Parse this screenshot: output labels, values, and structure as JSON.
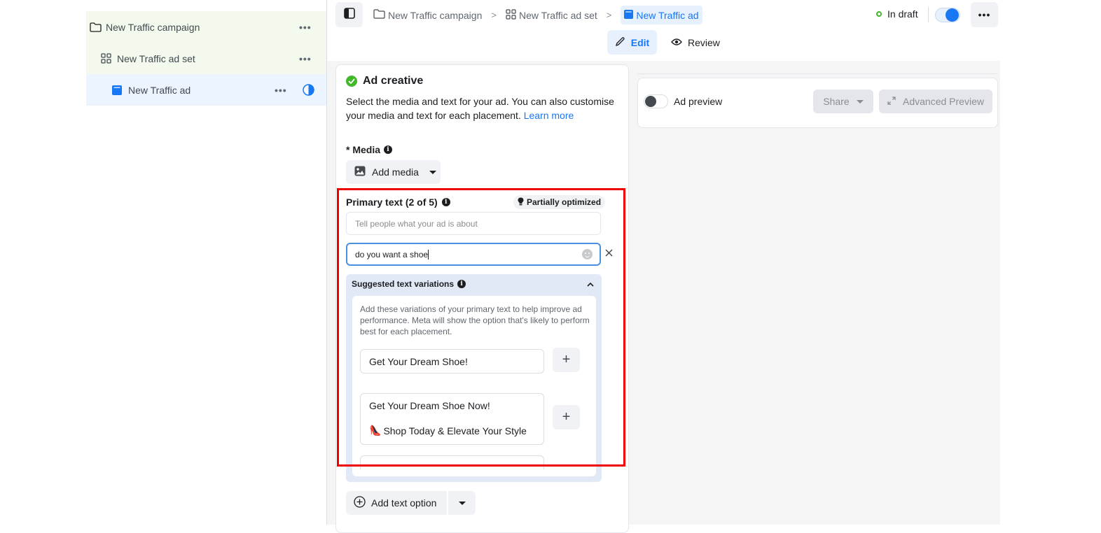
{
  "tree": {
    "campaign": {
      "label": "New Traffic campaign",
      "icon": "folder-icon",
      "more": "•••"
    },
    "adset": {
      "label": "New Traffic ad set",
      "icon": "grid-icon",
      "more": "•••"
    },
    "ad": {
      "label": "New Traffic ad",
      "icon": "ad-icon",
      "more": "•••",
      "status_icon": "half-circle-icon"
    }
  },
  "topbar": {
    "breadcrumbs": [
      {
        "label": "New Traffic campaign",
        "icon": "folder-icon"
      },
      {
        "label": "New Traffic ad set",
        "icon": "grid-icon"
      },
      {
        "label": "New Traffic ad",
        "icon": "ad-icon"
      }
    ],
    "separator": ">",
    "status": "In draft",
    "toggle_on": true,
    "more": "•••",
    "tabs": [
      {
        "label": "Edit",
        "active": true
      },
      {
        "label": "Review",
        "active": false
      }
    ]
  },
  "creative": {
    "title": "Ad creative",
    "description": "Select the media and text for your ad. You can also customise your media and text for each placement.",
    "learn_more": "Learn more",
    "media_label": "* Media",
    "add_media": "Add media",
    "primary_text_label": "Primary text (2 of 5)",
    "optimization_badge": "Partially optimized",
    "primary_text_placeholder": "Tell people what your ad is about",
    "primary_text_value": "do you want a shoe",
    "suggestions": {
      "title": "Suggested text variations",
      "description": "Add these variations of your primary text to help improve ad performance. Meta will show the option that's likely to perform best for each placement.",
      "items": [
        {
          "line1": "Get Your Dream Shoe!"
        },
        {
          "line1": "Get Your Dream Shoe Now!",
          "emoji": "👠",
          "line2": "Shop Today & Elevate Your Style"
        }
      ],
      "add_symbol": "+"
    },
    "add_text_option": "Add text option"
  },
  "preview": {
    "label": "Ad preview",
    "toggle_on": false,
    "share": "Share",
    "advanced_preview": "Advanced Preview"
  },
  "colors": {
    "accent": "#1877f2",
    "success": "#42b72a",
    "highlight": "#ee0000"
  }
}
